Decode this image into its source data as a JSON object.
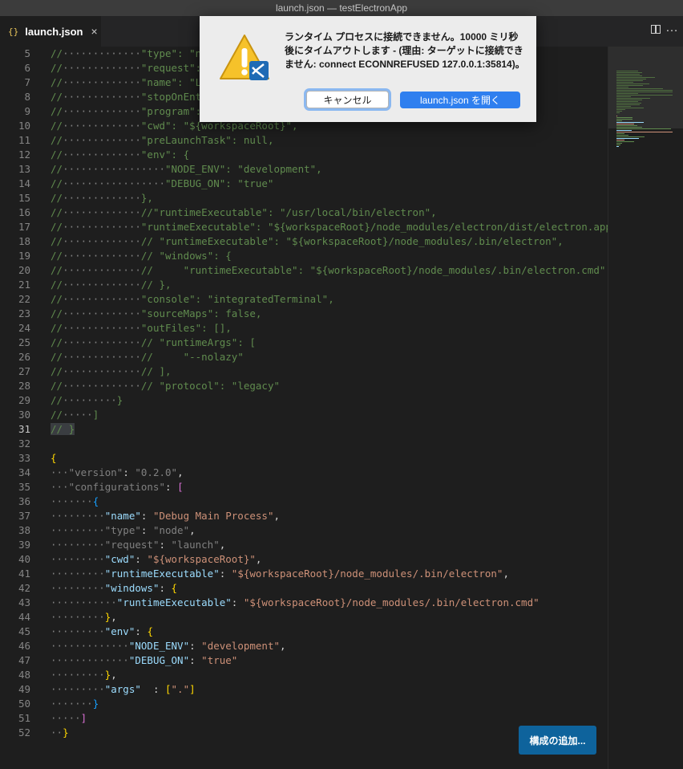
{
  "window": {
    "title": "launch.json — testElectronApp"
  },
  "tab": {
    "icon": "{}",
    "label": "launch.json",
    "close": "×"
  },
  "toolbar": {
    "split_icon": "split-editor-icon",
    "more_icon": "more-icon"
  },
  "dialog": {
    "icon": "warning-icon",
    "message": "ランタイム プロセスに接続できません。10000 ミリ秒後にタイムアウトします - (理由: ターゲットに接続できません: connect ECONNREFUSED 127.0.0.1:35814)。",
    "cancel_label": "キャンセル",
    "open_label": "launch.json を開く"
  },
  "editor": {
    "current_line": 31,
    "lines": [
      {
        "n": "5",
        "parts": [
          [
            "c",
            "//"
          ],
          [
            "dim",
            "·············"
          ],
          [
            "c",
            "\"type\": \"node\","
          ]
        ]
      },
      {
        "n": "6",
        "parts": [
          [
            "c",
            "//"
          ],
          [
            "dim",
            "·············"
          ],
          [
            "c",
            "\"request\": \"launch\","
          ]
        ]
      },
      {
        "n": "7",
        "parts": [
          [
            "c",
            "//"
          ],
          [
            "dim",
            "·············"
          ],
          [
            "c",
            "\"name\": \"Launch\","
          ]
        ]
      },
      {
        "n": "8",
        "parts": [
          [
            "c",
            "//"
          ],
          [
            "dim",
            "·············"
          ],
          [
            "c",
            "\"stopOnEntry\": false,"
          ]
        ]
      },
      {
        "n": "9",
        "parts": [
          [
            "c",
            "//"
          ],
          [
            "dim",
            "·············"
          ],
          [
            "c",
            "\"program\": \"${workspaceRoot}/main.js\","
          ]
        ]
      },
      {
        "n": "10",
        "parts": [
          [
            "c",
            "//"
          ],
          [
            "dim",
            "·············"
          ],
          [
            "c",
            "\"cwd\": \"${workspaceRoot}\","
          ]
        ]
      },
      {
        "n": "11",
        "parts": [
          [
            "c",
            "//"
          ],
          [
            "dim",
            "·············"
          ],
          [
            "c",
            "\"preLaunchTask\": null,"
          ]
        ]
      },
      {
        "n": "12",
        "parts": [
          [
            "c",
            "//"
          ],
          [
            "dim",
            "·············"
          ],
          [
            "c",
            "\"env\": {"
          ]
        ]
      },
      {
        "n": "13",
        "parts": [
          [
            "c",
            "//"
          ],
          [
            "dim",
            "·················"
          ],
          [
            "c",
            "\"NODE_ENV\": \"development\","
          ]
        ]
      },
      {
        "n": "14",
        "parts": [
          [
            "c",
            "//"
          ],
          [
            "dim",
            "·················"
          ],
          [
            "c",
            "\"DEBUG_ON\": \"true\""
          ]
        ]
      },
      {
        "n": "15",
        "parts": [
          [
            "c",
            "//"
          ],
          [
            "dim",
            "·············"
          ],
          [
            "c",
            "},"
          ]
        ]
      },
      {
        "n": "16",
        "parts": [
          [
            "c",
            "//"
          ],
          [
            "dim",
            "·············"
          ],
          [
            "c",
            "//\"runtimeExecutable\": \"/usr/local/bin/electron\","
          ]
        ]
      },
      {
        "n": "17",
        "parts": [
          [
            "c",
            "//"
          ],
          [
            "dim",
            "·············"
          ],
          [
            "c",
            "\"runtimeExecutable\": \"${workspaceRoot}/node_modules/electron/dist/electron.app/Con"
          ]
        ]
      },
      {
        "n": "18",
        "parts": [
          [
            "c",
            "//"
          ],
          [
            "dim",
            "·············"
          ],
          [
            "c",
            "// \"runtimeExecutable\": \"${workspaceRoot}/node_modules/.bin/electron\","
          ]
        ]
      },
      {
        "n": "19",
        "parts": [
          [
            "c",
            "//"
          ],
          [
            "dim",
            "·············"
          ],
          [
            "c",
            "// \"windows\": {"
          ]
        ]
      },
      {
        "n": "20",
        "parts": [
          [
            "c",
            "//"
          ],
          [
            "dim",
            "·············"
          ],
          [
            "c",
            "//     \"runtimeExecutable\": \"${workspaceRoot}/node_modules/.bin/electron.cmd\""
          ]
        ]
      },
      {
        "n": "21",
        "parts": [
          [
            "c",
            "//"
          ],
          [
            "dim",
            "·············"
          ],
          [
            "c",
            "// },"
          ]
        ]
      },
      {
        "n": "22",
        "parts": [
          [
            "c",
            "//"
          ],
          [
            "dim",
            "·············"
          ],
          [
            "c",
            "\"console\": \"integratedTerminal\","
          ]
        ]
      },
      {
        "n": "23",
        "parts": [
          [
            "c",
            "//"
          ],
          [
            "dim",
            "·············"
          ],
          [
            "c",
            "\"sourceMaps\": false,"
          ]
        ]
      },
      {
        "n": "24",
        "parts": [
          [
            "c",
            "//"
          ],
          [
            "dim",
            "·············"
          ],
          [
            "c",
            "\"outFiles\": [],"
          ]
        ]
      },
      {
        "n": "25",
        "parts": [
          [
            "c",
            "//"
          ],
          [
            "dim",
            "·············"
          ],
          [
            "c",
            "// \"runtimeArgs\": ["
          ]
        ]
      },
      {
        "n": "26",
        "parts": [
          [
            "c",
            "//"
          ],
          [
            "dim",
            "·············"
          ],
          [
            "c",
            "//     \"--nolazy\""
          ]
        ]
      },
      {
        "n": "27",
        "parts": [
          [
            "c",
            "//"
          ],
          [
            "dim",
            "·············"
          ],
          [
            "c",
            "// ],"
          ]
        ]
      },
      {
        "n": "28",
        "parts": [
          [
            "c",
            "//"
          ],
          [
            "dim",
            "·············"
          ],
          [
            "c",
            "// \"protocol\": \"legacy\""
          ]
        ]
      },
      {
        "n": "29",
        "parts": [
          [
            "c",
            "//"
          ],
          [
            "dim",
            "·········"
          ],
          [
            "c",
            "}"
          ]
        ]
      },
      {
        "n": "30",
        "parts": [
          [
            "c",
            "//"
          ],
          [
            "dim",
            "·····"
          ],
          [
            "c",
            "]"
          ]
        ]
      },
      {
        "n": "31",
        "parts": [
          [
            "c",
            "// }"
          ]
        ]
      },
      {
        "n": "32",
        "parts": []
      },
      {
        "n": "33",
        "parts": [
          [
            "b1",
            "{"
          ]
        ]
      },
      {
        "n": "34",
        "parts": [
          [
            "dim",
            "···"
          ],
          [
            "dim",
            "\"version\""
          ],
          [
            "p",
            ": "
          ],
          [
            "dim",
            "\"0.2.0\""
          ],
          [
            "p",
            ","
          ]
        ]
      },
      {
        "n": "35",
        "parts": [
          [
            "dim",
            "···"
          ],
          [
            "dim",
            "\"configurations\""
          ],
          [
            "p",
            ": "
          ],
          [
            "b2",
            "["
          ]
        ]
      },
      {
        "n": "36",
        "parts": [
          [
            "dim",
            "·······"
          ],
          [
            "b3",
            "{"
          ]
        ]
      },
      {
        "n": "37",
        "parts": [
          [
            "dim",
            "·········"
          ],
          [
            "k",
            "\"name\""
          ],
          [
            "p",
            ": "
          ],
          [
            "s",
            "\"Debug Main Process\""
          ],
          [
            "p",
            ","
          ]
        ]
      },
      {
        "n": "38",
        "parts": [
          [
            "dim",
            "·········"
          ],
          [
            "dim",
            "\"type\""
          ],
          [
            "p",
            ": "
          ],
          [
            "dim",
            "\"node\""
          ],
          [
            "p",
            ","
          ]
        ]
      },
      {
        "n": "39",
        "parts": [
          [
            "dim",
            "·········"
          ],
          [
            "dim",
            "\"request\""
          ],
          [
            "p",
            ": "
          ],
          [
            "dim",
            "\"launch\""
          ],
          [
            "p",
            ","
          ]
        ]
      },
      {
        "n": "40",
        "parts": [
          [
            "dim",
            "·········"
          ],
          [
            "k",
            "\"cwd\""
          ],
          [
            "p",
            ": "
          ],
          [
            "s",
            "\"${workspaceRoot}\""
          ],
          [
            "p",
            ","
          ]
        ]
      },
      {
        "n": "41",
        "parts": [
          [
            "dim",
            "·········"
          ],
          [
            "k",
            "\"runtimeExecutable\""
          ],
          [
            "p",
            ": "
          ],
          [
            "s",
            "\"${workspaceRoot}/node_modules/.bin/electron\""
          ],
          [
            "p",
            ","
          ]
        ]
      },
      {
        "n": "42",
        "parts": [
          [
            "dim",
            "·········"
          ],
          [
            "k",
            "\"windows\""
          ],
          [
            "p",
            ": "
          ],
          [
            "b1",
            "{"
          ]
        ]
      },
      {
        "n": "43",
        "parts": [
          [
            "dim",
            "···········"
          ],
          [
            "k",
            "\"runtimeExecutable\""
          ],
          [
            "p",
            ": "
          ],
          [
            "s",
            "\"${workspaceRoot}/node_modules/.bin/electron.cmd\""
          ]
        ]
      },
      {
        "n": "44",
        "parts": [
          [
            "dim",
            "·········"
          ],
          [
            "b1",
            "}"
          ],
          [
            "p",
            ","
          ]
        ]
      },
      {
        "n": "45",
        "parts": [
          [
            "dim",
            "·········"
          ],
          [
            "k",
            "\"env\""
          ],
          [
            "p",
            ": "
          ],
          [
            "b1",
            "{"
          ]
        ]
      },
      {
        "n": "46",
        "parts": [
          [
            "dim",
            "·············"
          ],
          [
            "k",
            "\"NODE_ENV\""
          ],
          [
            "p",
            ": "
          ],
          [
            "s",
            "\"development\""
          ],
          [
            "p",
            ","
          ]
        ]
      },
      {
        "n": "47",
        "parts": [
          [
            "dim",
            "·············"
          ],
          [
            "k",
            "\"DEBUG_ON\""
          ],
          [
            "p",
            ": "
          ],
          [
            "s",
            "\"true\""
          ]
        ]
      },
      {
        "n": "48",
        "parts": [
          [
            "dim",
            "·········"
          ],
          [
            "b1",
            "}"
          ],
          [
            "p",
            ","
          ]
        ]
      },
      {
        "n": "49",
        "parts": [
          [
            "dim",
            "·········"
          ],
          [
            "k",
            "\"args\""
          ],
          [
            "p",
            "  : "
          ],
          [
            "b1",
            "["
          ],
          [
            "s",
            "\".\""
          ],
          [
            "b1",
            "]"
          ]
        ]
      },
      {
        "n": "50",
        "parts": [
          [
            "dim",
            "·······"
          ],
          [
            "b3",
            "}"
          ]
        ]
      },
      {
        "n": "51",
        "parts": [
          [
            "dim",
            "·····"
          ],
          [
            "b2",
            "]"
          ]
        ]
      },
      {
        "n": "52",
        "parts": [
          [
            "dim",
            "··"
          ],
          [
            "b1",
            "}"
          ]
        ]
      }
    ]
  },
  "add_config": {
    "label": "構成の追加..."
  }
}
